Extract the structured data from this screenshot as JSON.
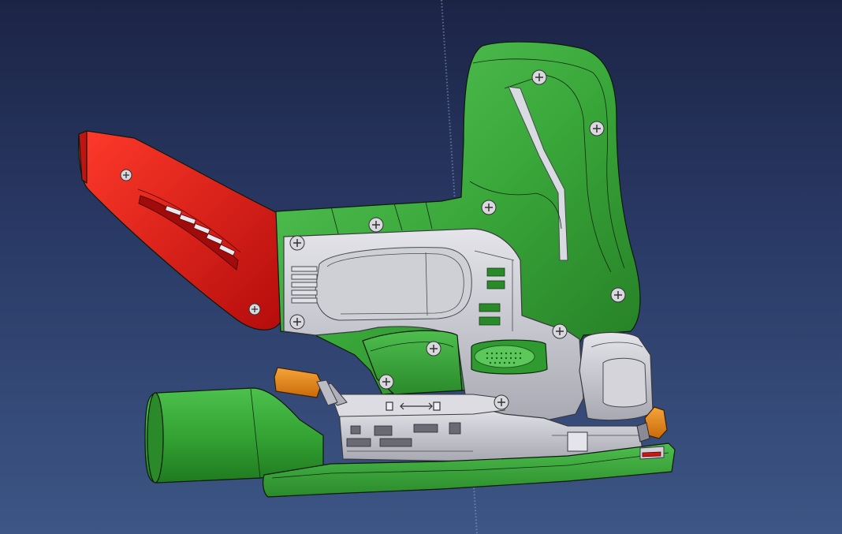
{
  "viewer": {
    "background_top": "#1c2446",
    "background_bottom": "#3d5685"
  },
  "model": {
    "colors": {
      "housing": "#3aa83a",
      "dust_chute": "#d81818",
      "metal": "#c8c8cc",
      "base_plate": "#3aa83a",
      "lever": "#e88a18",
      "blade_clamp": "#e89a2a"
    }
  }
}
